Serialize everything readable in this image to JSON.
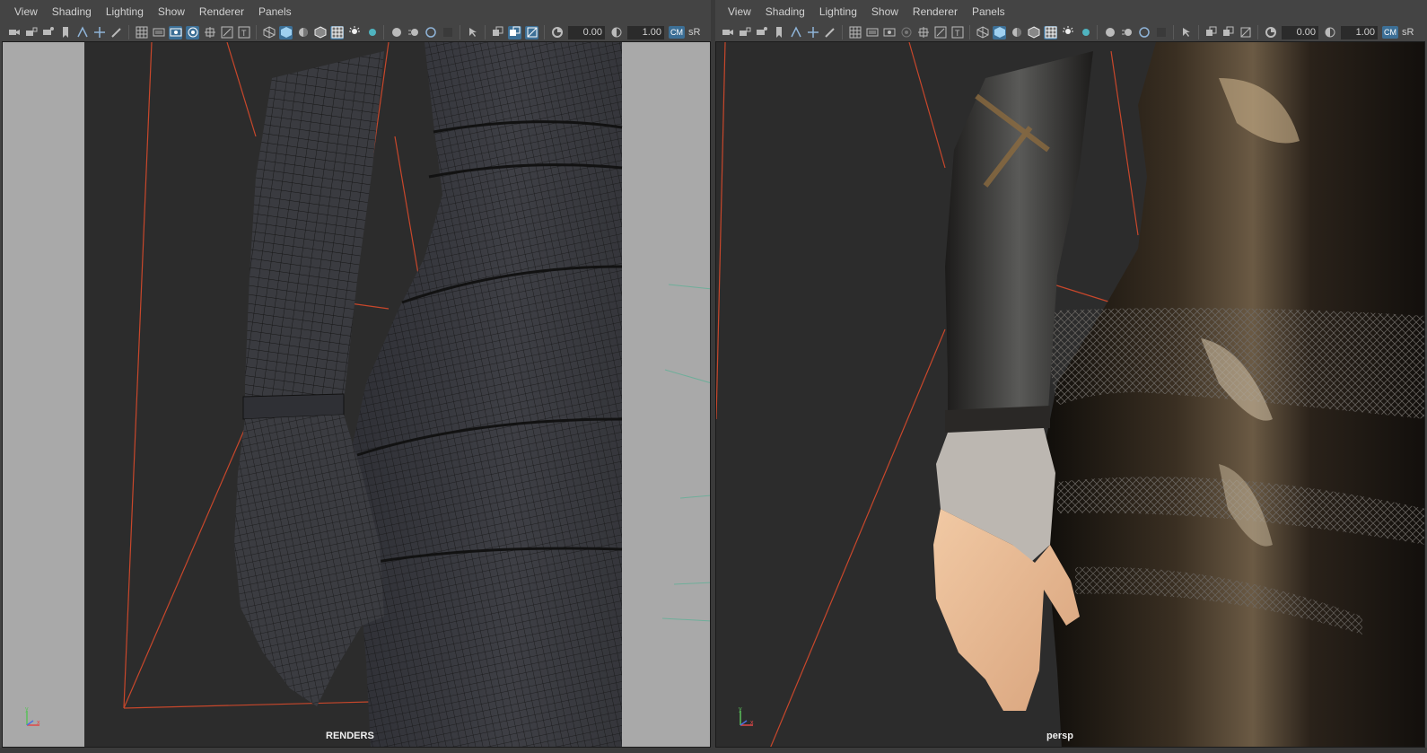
{
  "menus": {
    "view": "View",
    "shading": "Shading",
    "lighting": "Lighting",
    "show": "Show",
    "renderer": "Renderer",
    "panels": "Panels"
  },
  "toolbar": {
    "exposure": "0.00",
    "gamma": "1.00",
    "color_mgmt_badge": "CM",
    "color_space_short": "sR"
  },
  "viewports": {
    "left": {
      "camera_label": "RENDERS",
      "axis_y": "y",
      "axis_x": "x",
      "shading": "wireframe-on-shaded"
    },
    "right": {
      "camera_label": "persp",
      "axis_y": "y",
      "axis_x": "x",
      "shading": "textured-lit"
    }
  },
  "colors": {
    "ui_background": "#444444",
    "viewport_background": "#2c2c2c",
    "gate_mask": "#a9a9a9",
    "camera_frustum": "#c8472b",
    "selection_highlight": "#3c6f96"
  }
}
